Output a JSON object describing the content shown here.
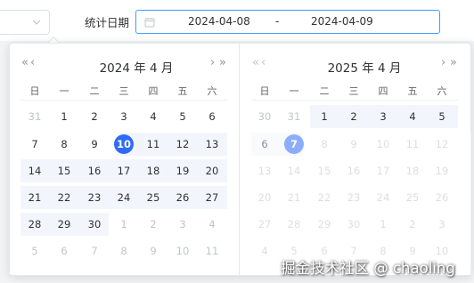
{
  "filter": {
    "label": "统计日期",
    "start": "2024-04-08",
    "separator": "-",
    "end": "2024-04-09"
  },
  "icons": {
    "calendar": "calendar-icon",
    "chevron": "chevron-down-icon",
    "prev_year": "«",
    "prev_month": "‹",
    "next_month": "›",
    "next_year": "»"
  },
  "weekdays": [
    "日",
    "一",
    "二",
    "三",
    "四",
    "五",
    "六"
  ],
  "colors": {
    "accent": "#2f6cf6",
    "border_focus": "#409eff",
    "range_bg": "#f2f6fc",
    "muted": "#c0c4cc"
  },
  "left_calendar": {
    "title": "2024 年 4 月",
    "rows": [
      [
        "31",
        "1",
        "2",
        "3",
        "4",
        "5",
        "6"
      ],
      [
        "7",
        "8",
        "9",
        "10",
        "11",
        "12",
        "13"
      ],
      [
        "14",
        "15",
        "16",
        "17",
        "18",
        "19",
        "20"
      ],
      [
        "21",
        "22",
        "23",
        "24",
        "25",
        "26",
        "27"
      ],
      [
        "28",
        "29",
        "30",
        "1",
        "2",
        "3",
        "4"
      ],
      [
        "5",
        "6",
        "7",
        "8",
        "9",
        "10",
        "11"
      ]
    ],
    "selected": "10"
  },
  "right_calendar": {
    "title": "2025 年 4 月",
    "rows": [
      [
        "30",
        "31",
        "1",
        "2",
        "3",
        "4",
        "5"
      ],
      [
        "6",
        "7",
        "8",
        "9",
        "10",
        "11",
        "12"
      ],
      [
        "13",
        "14",
        "15",
        "16",
        "17",
        "18",
        "19"
      ],
      [
        "20",
        "21",
        "22",
        "23",
        "24",
        "25",
        "26"
      ],
      [
        "27",
        "28",
        "29",
        "30",
        "1",
        "2",
        "3"
      ],
      [
        "4",
        "5",
        "6",
        "7",
        "8",
        "9",
        "10"
      ]
    ],
    "selected": "7"
  },
  "watermark": "掘金技术社区 @ chaoling"
}
